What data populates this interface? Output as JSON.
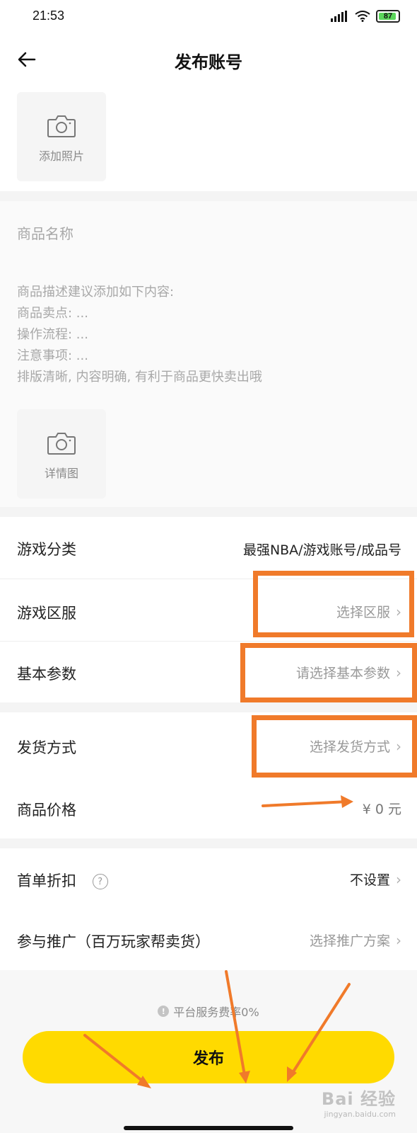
{
  "status_bar": {
    "time": "21:53",
    "battery": "87"
  },
  "nav": {
    "title": "发布账号"
  },
  "photos": {
    "add_photo_label": "添加照片",
    "detail_photo_label": "详情图"
  },
  "description": {
    "name_placeholder": "商品名称",
    "hint_lines": [
      "商品描述建议添加如下内容:",
      "商品卖点: ...",
      "操作流程: ...",
      "注意事项: ...",
      "排版清晰, 内容明确, 有利于商品更快卖出哦"
    ]
  },
  "form": {
    "game_category": {
      "label": "游戏分类",
      "value": "最强NBA/游戏账号/成品号"
    },
    "game_server": {
      "label": "游戏区服",
      "value": "选择区服"
    },
    "basic_params": {
      "label": "基本参数",
      "value": "请选择基本参数"
    },
    "delivery": {
      "label": "发货方式",
      "value": "选择发货方式"
    },
    "price": {
      "label": "商品价格",
      "value": "¥ 0 元"
    },
    "first_discount": {
      "label": "首单折扣",
      "value": "不设置"
    },
    "promotion": {
      "label": "参与推广（百万玩家帮卖货）",
      "value": "选择推广方案"
    }
  },
  "footer": {
    "fee_note": "平台服务费率0%",
    "publish_label": "发布"
  },
  "watermark": {
    "brand": "Bai 经验",
    "url": "jingyan.baidu.com"
  },
  "colors": {
    "accent": "#ffda00",
    "annotation": "#f07a2a"
  },
  "icons": [
    "back-arrow-icon",
    "camera-icon",
    "chevron-right-icon",
    "help-icon",
    "info-icon",
    "signal-icon",
    "wifi-icon",
    "battery-icon"
  ]
}
